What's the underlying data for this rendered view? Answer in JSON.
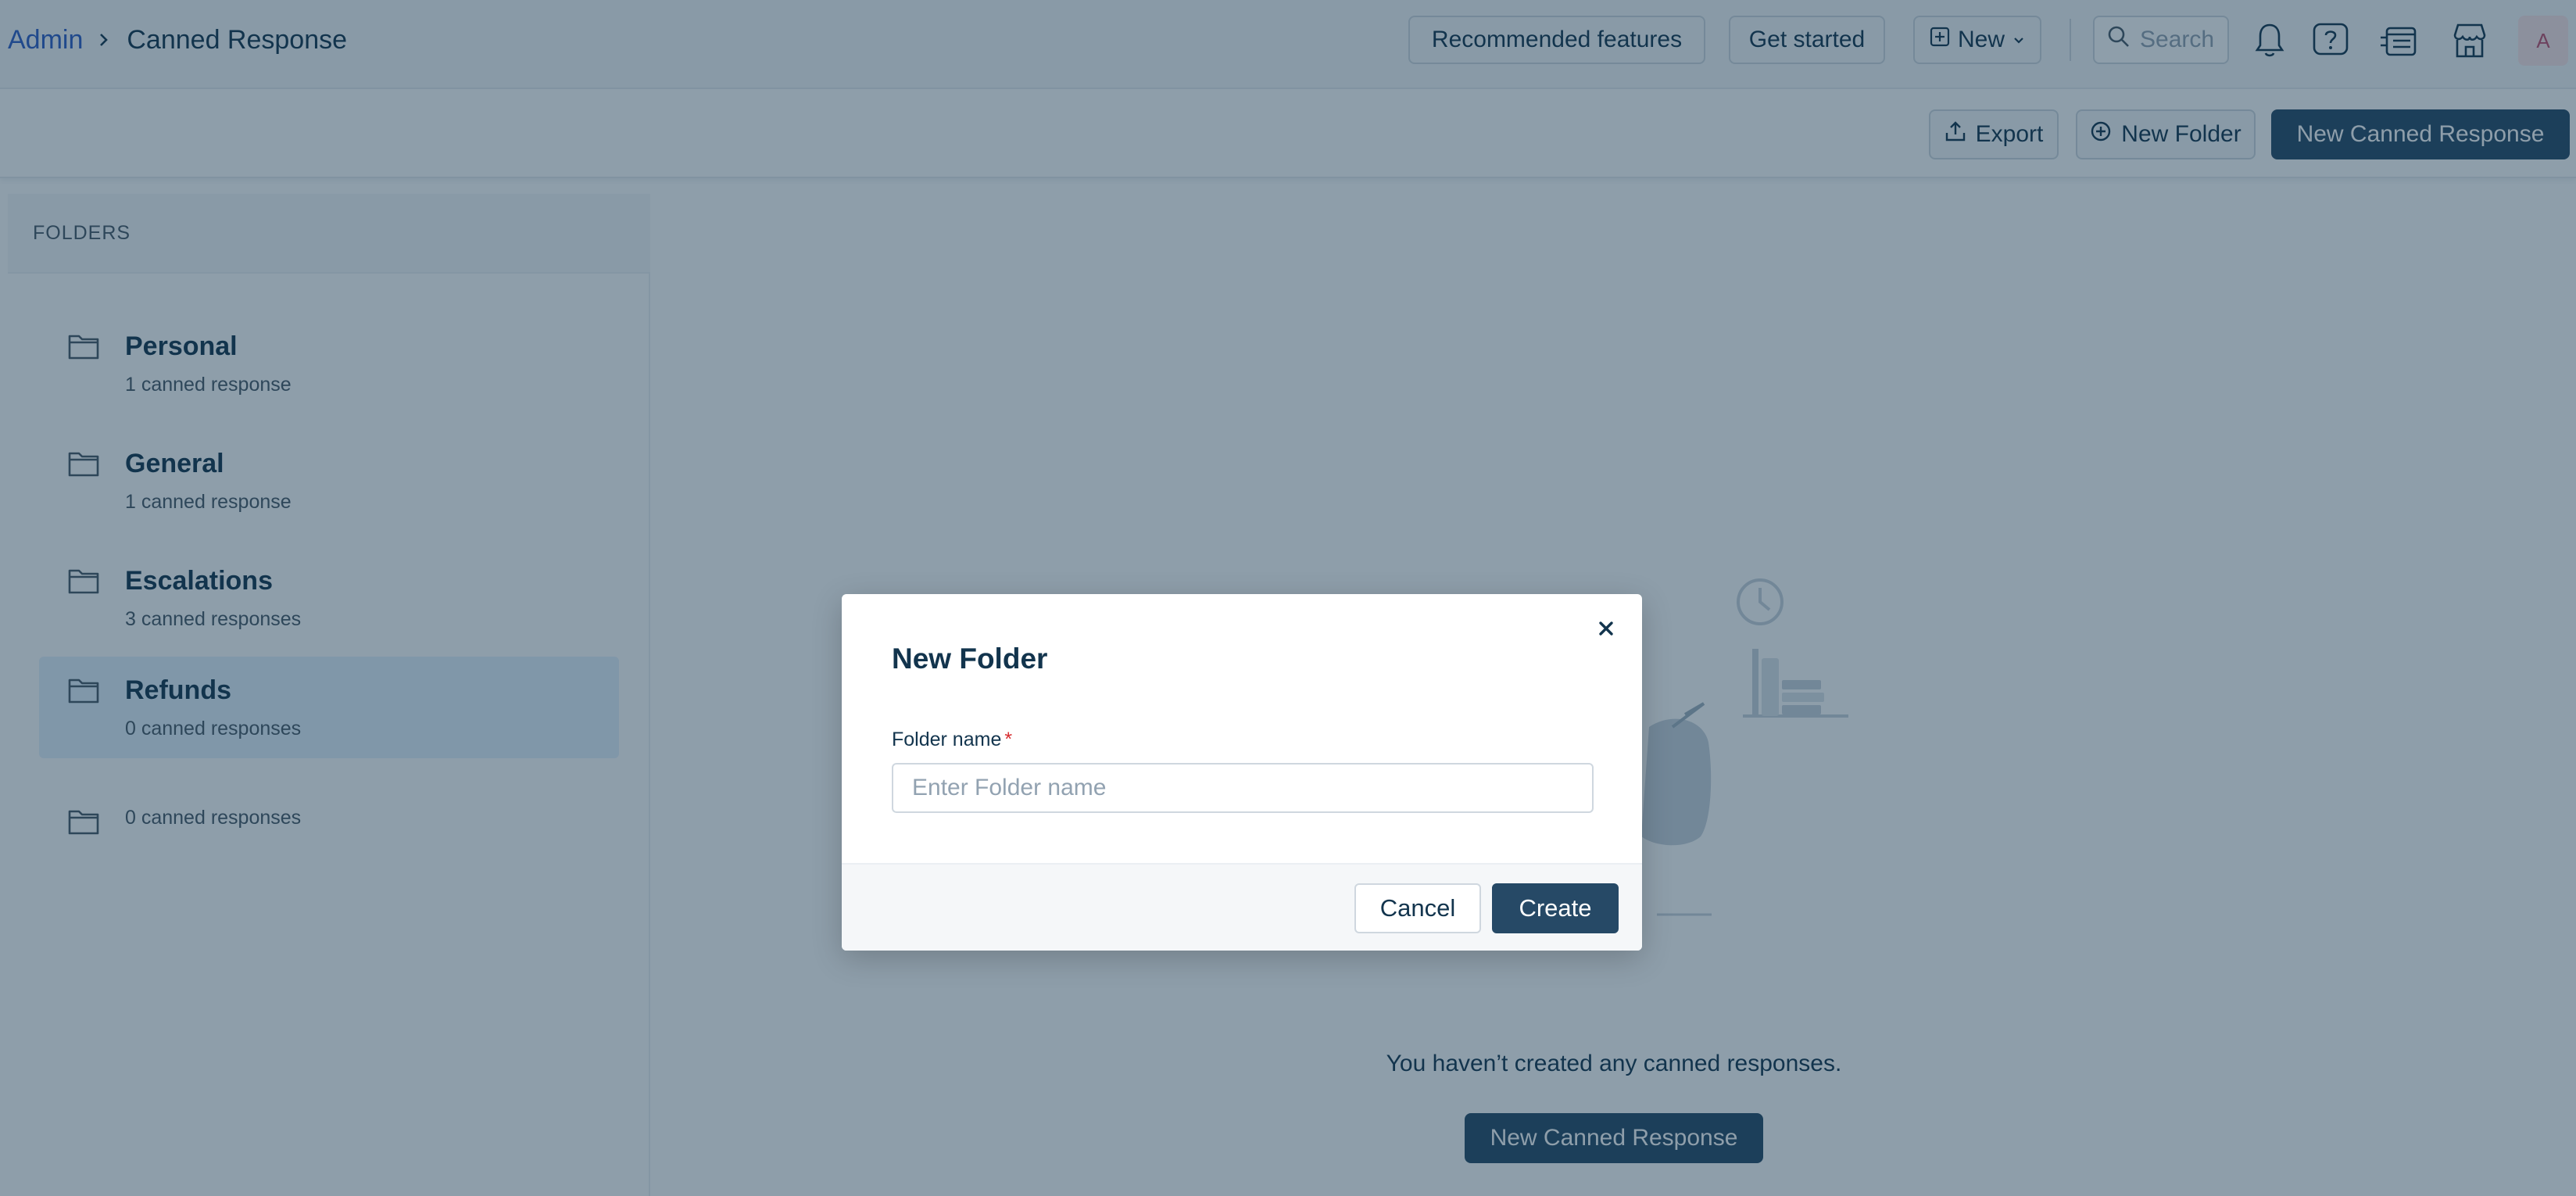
{
  "breadcrumb": {
    "parent": "Admin",
    "current": "Canned Response"
  },
  "header": {
    "recommended_label": "Recommended features",
    "get_started_label": "Get started",
    "new_label": "New",
    "search_placeholder": "Search",
    "avatar_initial": "A",
    "icons": [
      "bell-icon",
      "help-icon",
      "announcements-icon",
      "marketplace-icon"
    ]
  },
  "toolbar": {
    "export_label": "Export",
    "new_folder_label": "New Folder",
    "new_canned_label": "New Canned Response"
  },
  "sidebar": {
    "title": "FOLDERS",
    "folders": [
      {
        "name": "Personal",
        "count": "1 canned response"
      },
      {
        "name": "General",
        "count": "1 canned response"
      },
      {
        "name": "Escalations",
        "count": "3 canned responses"
      },
      {
        "name": "Refunds",
        "count": "0 canned responses",
        "active": true
      },
      {
        "name": "",
        "count": "0 canned responses"
      }
    ]
  },
  "main": {
    "empty_text": "You haven’t created any canned responses.",
    "empty_button_label": "New Canned Response"
  },
  "modal": {
    "title": "New Folder",
    "field_label": "Folder name",
    "required_marker": "*",
    "field_placeholder": "Enter Folder name",
    "field_value": "",
    "cancel_label": "Cancel",
    "create_label": "Create"
  },
  "colors": {
    "primary": "#264966",
    "link": "#2c5cc5",
    "text": "#12344d",
    "active_folder_bg": "#e5f2fd",
    "required": "#d72d30"
  }
}
